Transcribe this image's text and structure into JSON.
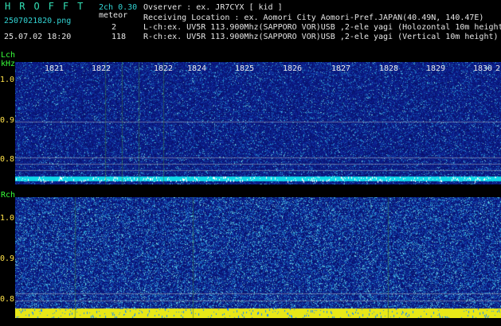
{
  "header": {
    "logo": "HROFFT",
    "version": "2ch 0.30",
    "filename": "2507021820.png",
    "mode": "meteor",
    "datetime": "25.07.02 18:20",
    "count_a": "2",
    "count_b": "118",
    "observer_line": "Ovserver           : ex. JR7CYX [ kid ]",
    "location_line": "Receiving Location : ex. Aomori City Aomori-Pref.JAPAN(40.49N, 140.47E)",
    "lch_line": "L-ch:ex. UV5R 113.900Mhz(SAPPORO VOR)USB ,2-ele yagi (Holozontal 10m height)",
    "rch_line": "R-ch:ex. UV5R 113.900Mhz(SAPPORO VOR)USB ,2-ele yagi (Vertical 10m height)"
  },
  "lch": {
    "label": "Lch",
    "unit": "kHz",
    "ticks": [
      "1.0",
      "0.9",
      "0.8"
    ]
  },
  "rch": {
    "label": "Rch",
    "ticks": [
      "1.0",
      "0.9",
      "0.8"
    ]
  },
  "time_labels": [
    "1821",
    "1822",
    "1822",
    "1824",
    "1825",
    "1826",
    "1827",
    "1828",
    "1829",
    "1830",
    "2"
  ],
  "colors": {
    "background": "#000000",
    "spectrum_base": "#0a1a6e",
    "carrier_line": "#00e0ff",
    "signal_bar": "#ffff00",
    "label_cyan": "#32d4d4",
    "label_yellow": "#ffd84a"
  }
}
